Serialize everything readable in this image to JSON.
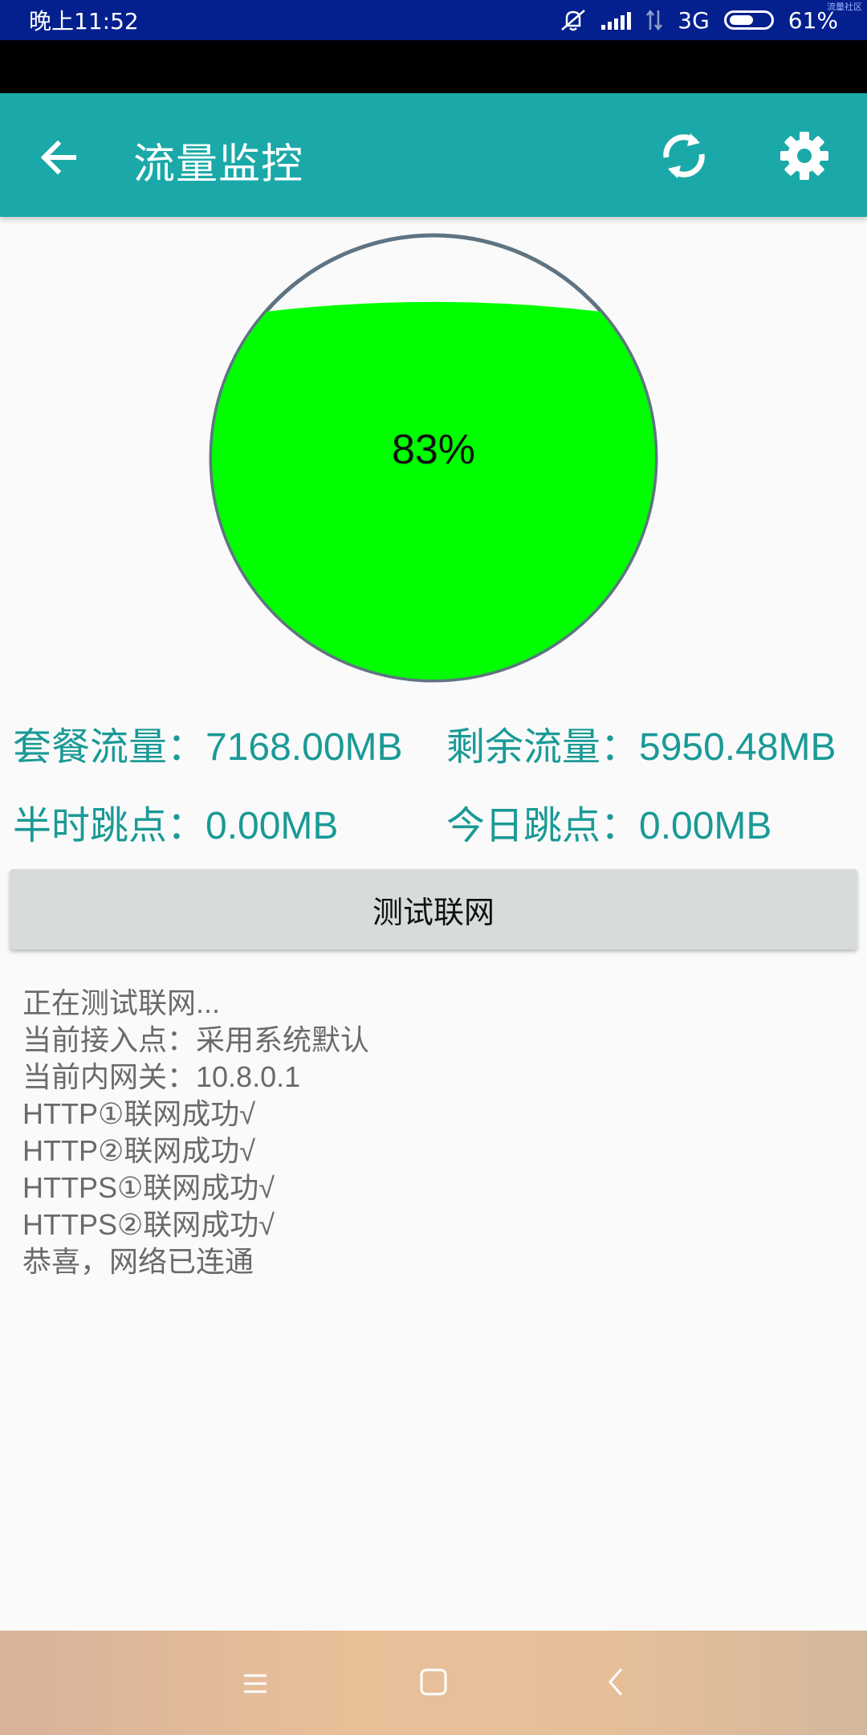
{
  "status_bar": {
    "time": "晚上11:52",
    "network": "3G",
    "battery": "61%",
    "battery_level": 0.61,
    "corner_text": "流量社区"
  },
  "app_bar": {
    "title": "流量监控",
    "back_icon": "arrow-left-icon",
    "refresh_icon": "sync-icon",
    "settings_icon": "gear-icon"
  },
  "gauge": {
    "percent_label": "83%",
    "fill_fraction": 0.83,
    "fill_color": "#00ff00",
    "ring_color": "#5f7482"
  },
  "stats": {
    "plan_traffic": "套餐流量：7168.00MB",
    "remaining_traffic": "剩余流量：5950.48MB",
    "half_hour_jump": "半时跳点：0.00MB",
    "today_jump": "今日跳点：0.00MB"
  },
  "test_button": {
    "label": "测试联网"
  },
  "log": {
    "lines": [
      "正在测试联网...",
      "当前接入点：采用系统默认",
      "当前内网关：10.8.0.1",
      "HTTP①联网成功√",
      "HTTP②联网成功√",
      "HTTPS①联网成功√",
      "HTTPS②联网成功√",
      "恭喜，网络已连通"
    ]
  },
  "nav_bar": {
    "menu_icon": "menu-icon",
    "home_icon": "home-square-icon",
    "back_icon": "chevron-left-icon"
  },
  "colors": {
    "status_bar": "#04208e",
    "app_bar": "#1aa9a8",
    "accent_text": "#1a9a96",
    "button_bg": "#d8dbdb"
  }
}
